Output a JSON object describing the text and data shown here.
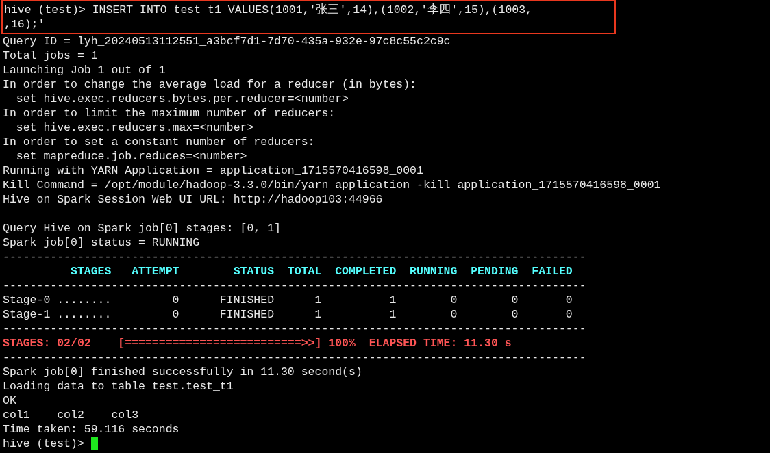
{
  "command": {
    "highlighted": true,
    "lines": [
      "hive (test)> INSERT INTO test_t1 VALUES(1001,'张三',14),(1002,'李四',15),(1003,",
      ",16);'"
    ]
  },
  "output": [
    {
      "kind": "text",
      "text": "Query ID = lyh_20240513112551_a3bcf7d1-7d70-435a-932e-97c8c55c2c9c"
    },
    {
      "kind": "text",
      "text": "Total jobs = 1"
    },
    {
      "kind": "text",
      "text": "Launching Job 1 out of 1"
    },
    {
      "kind": "text",
      "text": "In order to change the average load for a reducer (in bytes):"
    },
    {
      "kind": "text",
      "text": "  set hive.exec.reducers.bytes.per.reducer=<number>"
    },
    {
      "kind": "text",
      "text": "In order to limit the maximum number of reducers:"
    },
    {
      "kind": "text",
      "text": "  set hive.exec.reducers.max=<number>"
    },
    {
      "kind": "text",
      "text": "In order to set a constant number of reducers:"
    },
    {
      "kind": "text",
      "text": "  set mapreduce.job.reduces=<number>"
    },
    {
      "kind": "text",
      "text": "Running with YARN Application = application_1715570416598_0001"
    },
    {
      "kind": "text",
      "text": "Kill Command = /opt/module/hadoop-3.3.0/bin/yarn application -kill application_1715570416598_0001"
    },
    {
      "kind": "text",
      "text": "Hive on Spark Session Web UI URL: http://hadoop103:44966"
    },
    {
      "kind": "blank"
    },
    {
      "kind": "text",
      "text": "Query Hive on Spark job[0] stages: [0, 1]"
    },
    {
      "kind": "text",
      "text": "Spark job[0] status = RUNNING"
    },
    {
      "kind": "rule",
      "text": "--------------------------------------------------------------------------------------"
    },
    {
      "kind": "header",
      "text": "          STAGES   ATTEMPT        STATUS  TOTAL  COMPLETED  RUNNING  PENDING  FAILED"
    },
    {
      "kind": "rule",
      "text": "--------------------------------------------------------------------------------------"
    },
    {
      "kind": "text",
      "text": "Stage-0 ........         0      FINISHED      1          1        0        0       0"
    },
    {
      "kind": "text",
      "text": "Stage-1 ........         0      FINISHED      1          1        0        0       0"
    },
    {
      "kind": "rule",
      "text": "--------------------------------------------------------------------------------------"
    },
    {
      "kind": "alert",
      "text": "STAGES: 02/02    [==========================>>] 100%  ELAPSED TIME: 11.30 s"
    },
    {
      "kind": "rule",
      "text": "--------------------------------------------------------------------------------------"
    },
    {
      "kind": "text",
      "text": "Spark job[0] finished successfully in 11.30 second(s)"
    },
    {
      "kind": "text",
      "text": "Loading data to table test.test_t1"
    },
    {
      "kind": "text",
      "text": "OK"
    },
    {
      "kind": "text",
      "text": "col1    col2    col3"
    },
    {
      "kind": "text",
      "text": "Time taken: 59.116 seconds"
    }
  ],
  "prompt": {
    "text": "hive (test)> ",
    "cursor": true
  }
}
